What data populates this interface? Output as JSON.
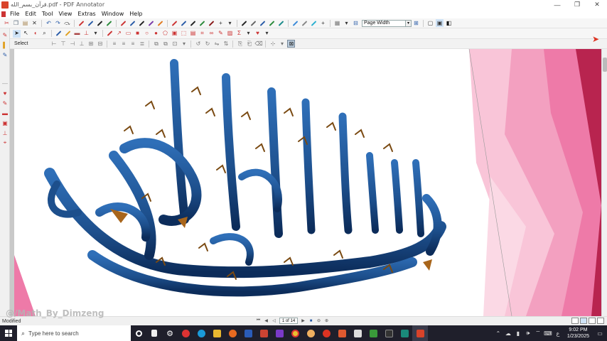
{
  "window": {
    "title": "قرآن_بسم_الله.pdf - PDF Annotator",
    "minimize": "—",
    "maximize": "❐",
    "close": "✕"
  },
  "menu": [
    "File",
    "Edit",
    "Tool",
    "View",
    "Extras",
    "Window",
    "Help"
  ],
  "toolbar": {
    "zoom_value": "Page Width",
    "select_label": "Select"
  },
  "statusbar": {
    "status": "Modified",
    "page_indicator": "1 of 14"
  },
  "watermark": "@/Math_By_Dimzeng",
  "taskbar": {
    "search_placeholder": "Type here to search",
    "clock_time": "9:02 PM",
    "clock_date": "1/23/2025"
  },
  "colors": {
    "calligraphy_blue": "#1d4f8c",
    "calligraphy_dark": "#0c2c5a",
    "ribbon_gold": "#a8651b",
    "pink_light": "#f9c5d8",
    "pink_mid": "#ee7aa8",
    "pink_deep": "#b8244f"
  }
}
